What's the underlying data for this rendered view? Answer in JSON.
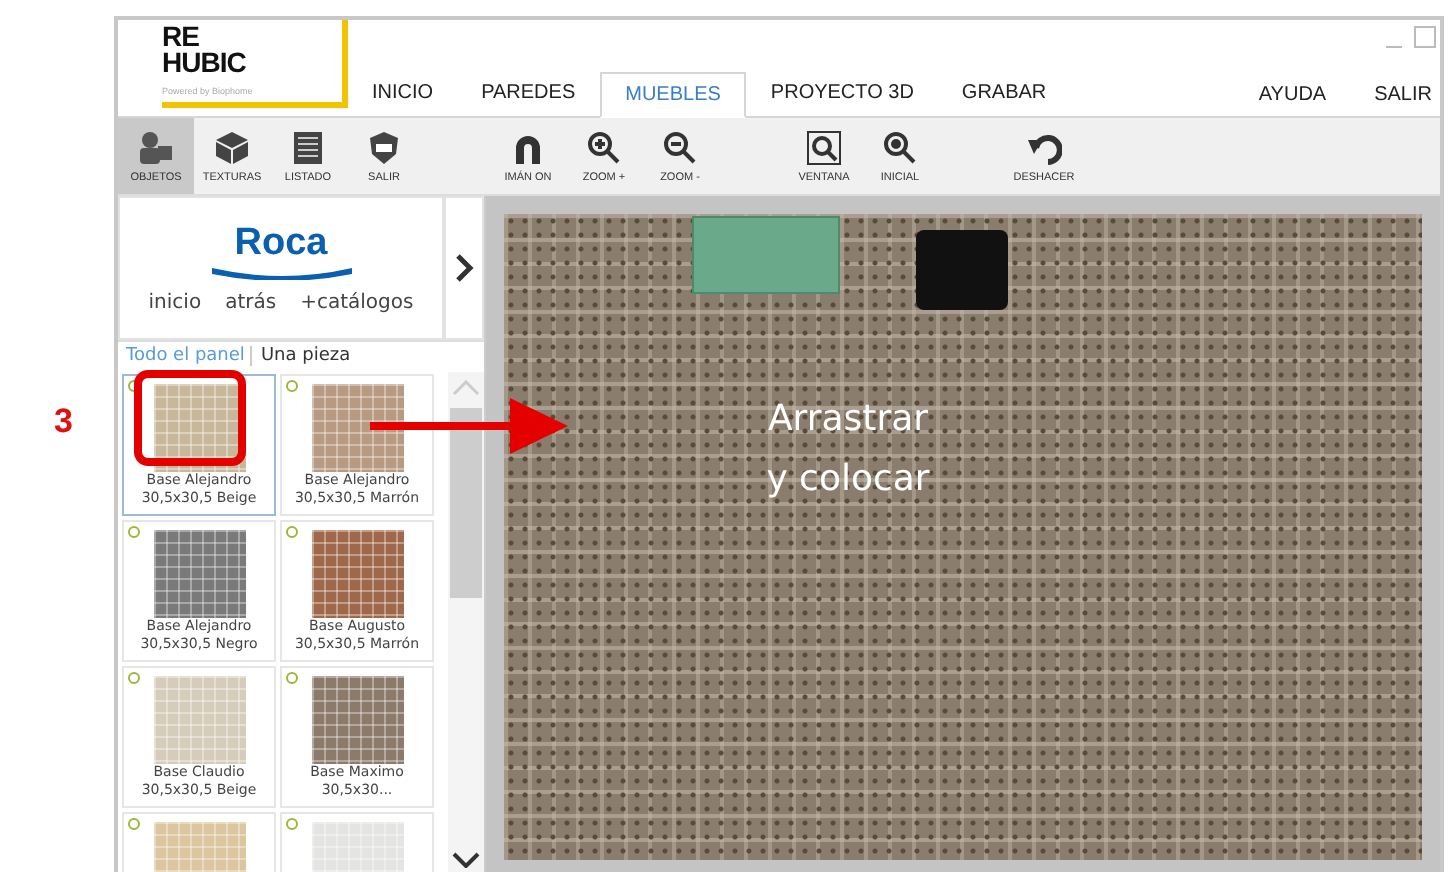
{
  "annotation": {
    "step": "3",
    "caption": "Arrastrar y colocar"
  },
  "logo": {
    "line1": "RE",
    "line2": "HUBIC",
    "tagline": "Powered by Biophome"
  },
  "tabs": [
    {
      "label": "INICIO",
      "selected": false
    },
    {
      "label": "PAREDES",
      "selected": false
    },
    {
      "label": "MUEBLES",
      "selected": true
    },
    {
      "label": "PROYECTO 3D",
      "selected": false
    },
    {
      "label": "GRABAR",
      "selected": false
    }
  ],
  "right_menu": [
    "AYUDA",
    "SALIR"
  ],
  "toolbar": [
    {
      "kind": "objects",
      "label": "OBJETOS",
      "selected": true
    },
    {
      "kind": "box",
      "label": "TEXTURAS",
      "selected": false
    },
    {
      "kind": "list",
      "label": "LISTADO",
      "selected": false
    },
    {
      "kind": "exit",
      "label": "SALIR",
      "selected": false
    },
    {
      "kind": "gap"
    },
    {
      "kind": "magnet",
      "label": "IMÁN ON",
      "selected": false
    },
    {
      "kind": "zoomin",
      "label": "ZOOM +",
      "selected": false
    },
    {
      "kind": "zoomout",
      "label": "ZOOM -",
      "selected": false
    },
    {
      "kind": "gap"
    },
    {
      "kind": "window",
      "label": "VENTANA",
      "selected": false
    },
    {
      "kind": "zoomfit",
      "label": "INICIAL",
      "selected": false
    },
    {
      "kind": "gap"
    },
    {
      "kind": "undo",
      "label": "DESHACER",
      "selected": false
    }
  ],
  "catalog": {
    "brand": "Roca",
    "links": [
      "inicio",
      "atrás",
      "+catálogos"
    ],
    "filters": [
      {
        "label": "Todo el panel",
        "selected": true
      },
      {
        "label": "Una pieza",
        "selected": false
      }
    ],
    "items": [
      {
        "name": "Base Alejandro",
        "size": "30,5x30,5 Beige",
        "color": "#c9b79c",
        "selected": true
      },
      {
        "name": "Base Alejandro",
        "size": "30,5x30,5 Marrón",
        "color": "#b89a82",
        "selected": false
      },
      {
        "name": "Base Alejandro",
        "size": "30,5x30,5 Negro",
        "color": "#7a7a7a",
        "selected": false
      },
      {
        "name": "Base Augusto",
        "size": "30,5x30,5 Marrón",
        "color": "#a0684a",
        "selected": false
      },
      {
        "name": "Base Claudio",
        "size": "30,5x30,5 Beige",
        "color": "#d6ccbb",
        "selected": false
      },
      {
        "name": "Base Maximo",
        "size": "30,5x30...",
        "color": "#8c7a6a",
        "selected": false
      },
      {
        "color": "#dcc6a0",
        "selected": false
      },
      {
        "color": "#e4e4e2",
        "selected": false
      }
    ]
  }
}
